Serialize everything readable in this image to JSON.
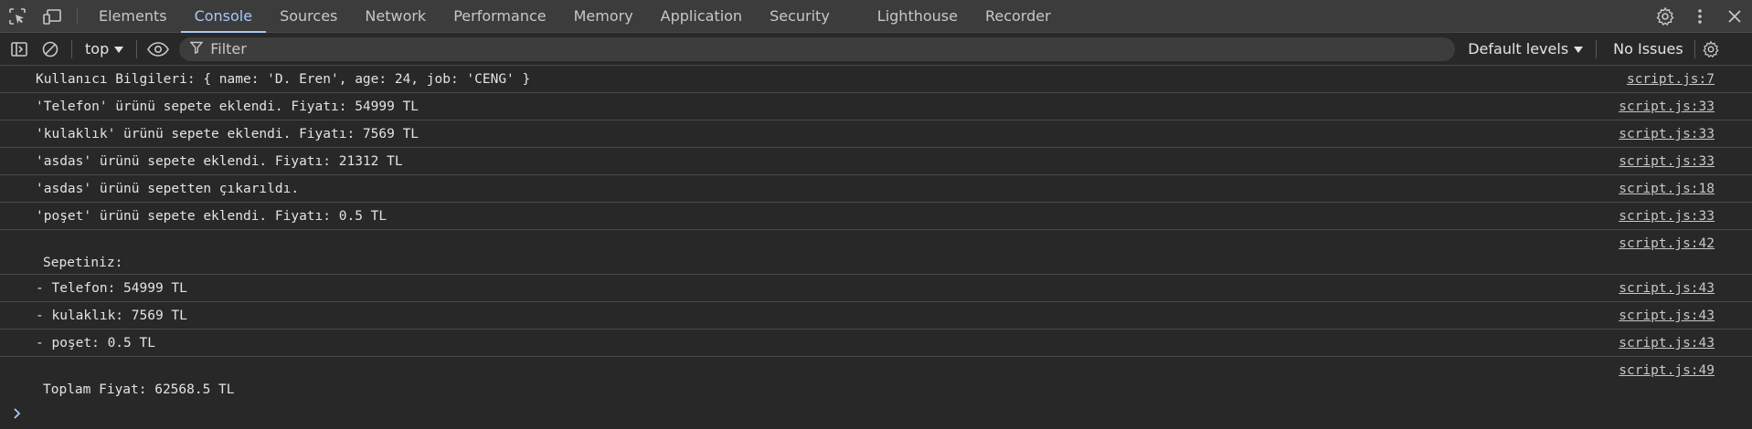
{
  "tabs": [
    "Elements",
    "Console",
    "Sources",
    "Network",
    "Performance",
    "Memory",
    "Application",
    "Security",
    "Lighthouse",
    "Recorder"
  ],
  "active_tab": "Console",
  "toolbar": {
    "context": "top",
    "filter_placeholder": "Filter",
    "levels": "Default levels",
    "issues": "No Issues"
  },
  "logs": [
    {
      "msg": "Kullanıcı Bilgileri: { name: 'D. Eren', age: 24, job: 'CENG' }",
      "src": "script.js:7"
    },
    {
      "msg": "'Telefon' ürünü sepete eklendi. Fiyatı: 54999 TL",
      "src": "script.js:33"
    },
    {
      "msg": "'kulaklık' ürünü sepete eklendi. Fiyatı: 7569 TL",
      "src": "script.js:33"
    },
    {
      "msg": "'asdas' ürünü sepete eklendi. Fiyatı: 21312 TL",
      "src": "script.js:33"
    },
    {
      "msg": "'asdas' ürünü sepetten çıkarıldı.",
      "src": "script.js:18"
    },
    {
      "msg": "'poşet' ürünü sepete eklendi. Fiyatı: 0.5 TL",
      "src": "script.js:33"
    },
    {
      "msg": "Sepetiniz:",
      "src": "script.js:42"
    },
    {
      "msg": "- Telefon: 54999 TL",
      "src": "script.js:43"
    },
    {
      "msg": "- kulaklık: 7569 TL",
      "src": "script.js:43"
    },
    {
      "msg": "- poşet: 0.5 TL",
      "src": "script.js:43"
    },
    {
      "msg": "Toplam Fiyat: 62568.5 TL",
      "src": "script.js:49"
    }
  ]
}
